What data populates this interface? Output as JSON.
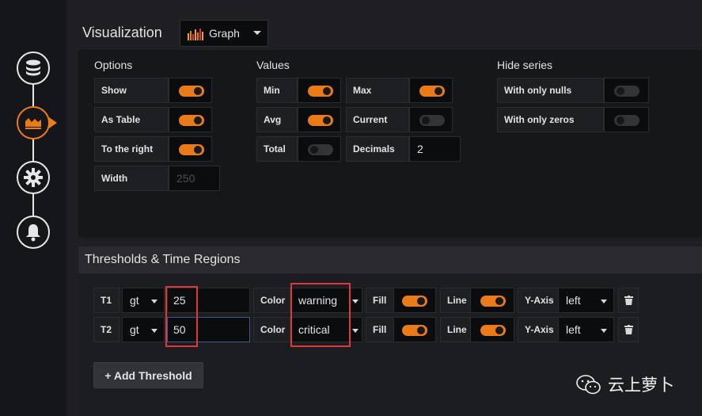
{
  "colors": {
    "accent": "#eb7b18",
    "highlight": "#e0373c"
  },
  "rail": {
    "items": [
      {
        "icon": "database-icon"
      },
      {
        "icon": "graph-icon",
        "active": true
      },
      {
        "icon": "gear-icon"
      },
      {
        "icon": "bell-icon"
      }
    ]
  },
  "visualization": {
    "title": "Visualization",
    "selected": "Graph",
    "icon": "graph-type-icon"
  },
  "options": {
    "heading": "Options",
    "show": {
      "label": "Show",
      "on": true
    },
    "as_table": {
      "label": "As Table",
      "on": true
    },
    "to_the_right": {
      "label": "To the right",
      "on": true
    },
    "width": {
      "label": "Width",
      "placeholder": "250"
    }
  },
  "values": {
    "heading": "Values",
    "min": {
      "label": "Min",
      "on": true
    },
    "max": {
      "label": "Max",
      "on": true
    },
    "avg": {
      "label": "Avg",
      "on": true
    },
    "current": {
      "label": "Current",
      "on": false
    },
    "total": {
      "label": "Total",
      "on": false
    },
    "decimals": {
      "label": "Decimals",
      "value": "2"
    }
  },
  "hide_series": {
    "heading": "Hide series",
    "only_nulls": {
      "label": "With only nulls",
      "on": false
    },
    "only_zeros": {
      "label": "With only zeros",
      "on": false
    }
  },
  "thresholds": {
    "heading": "Thresholds & Time Regions",
    "rows": [
      {
        "id": "T1",
        "op": "gt",
        "value": "25",
        "color_label": "Color",
        "color": "warning",
        "fill_label": "Fill",
        "fill": true,
        "line_label": "Line",
        "line": true,
        "yaxis_label": "Y-Axis",
        "yaxis": "left"
      },
      {
        "id": "T2",
        "op": "gt",
        "value": "50",
        "color_label": "Color",
        "color": "critical",
        "fill_label": "Fill",
        "fill": true,
        "line_label": "Line",
        "line": true,
        "yaxis_label": "Y-Axis",
        "yaxis": "left"
      }
    ],
    "add_label": "+ Add Threshold"
  },
  "watermark": {
    "text": "云上萝卜",
    "icon": "wechat-icon"
  }
}
